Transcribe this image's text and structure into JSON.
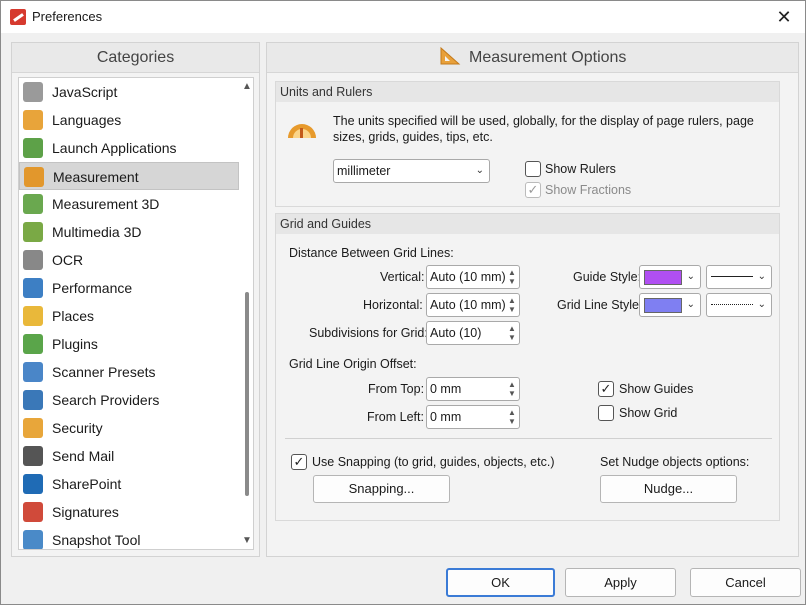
{
  "window": {
    "title": "Preferences"
  },
  "categories": {
    "heading": "Categories",
    "items": [
      {
        "label": "JavaScript",
        "icon": "javascript-icon",
        "color": "#9a9a9a"
      },
      {
        "label": "Languages",
        "icon": "languages-icon",
        "color": "#e8a43a"
      },
      {
        "label": "Launch Applications",
        "icon": "launch-applications-icon",
        "color": "#5da148"
      },
      {
        "label": "Measurement",
        "icon": "measurement-icon",
        "color": "#e2972c"
      },
      {
        "label": "Measurement 3D",
        "icon": "measurement-3d-icon",
        "color": "#6aa84f"
      },
      {
        "label": "Multimedia 3D",
        "icon": "multimedia-3d-icon",
        "color": "#7aa945"
      },
      {
        "label": "OCR",
        "icon": "ocr-icon",
        "color": "#888888"
      },
      {
        "label": "Performance",
        "icon": "performance-icon",
        "color": "#3d7fc4"
      },
      {
        "label": "Places",
        "icon": "places-icon",
        "color": "#e9b83a"
      },
      {
        "label": "Plugins",
        "icon": "plugins-icon",
        "color": "#5aa54a"
      },
      {
        "label": "Scanner Presets",
        "icon": "scanner-presets-icon",
        "color": "#4a86c8"
      },
      {
        "label": "Search Providers",
        "icon": "search-providers-icon",
        "color": "#3a78b8"
      },
      {
        "label": "Security",
        "icon": "security-icon",
        "color": "#e8a63a"
      },
      {
        "label": "Send Mail",
        "icon": "send-mail-icon",
        "color": "#555555"
      },
      {
        "label": "SharePoint",
        "icon": "sharepoint-icon",
        "color": "#1f6bb5"
      },
      {
        "label": "Signatures",
        "icon": "signatures-icon",
        "color": "#d04a3a"
      },
      {
        "label": "Snapshot Tool",
        "icon": "snapshot-tool-icon",
        "color": "#4a8ac8"
      }
    ],
    "selected_index": 3
  },
  "options": {
    "heading": "Measurement Options",
    "units": {
      "heading": "Units and Rulers",
      "description": "The units specified will be used, globally, for the display of page rulers, page sizes, grids, guides, tips, etc.",
      "unit_value": "millimeter",
      "show_rulers": {
        "label": "Show Rulers",
        "checked": false
      },
      "show_fractions": {
        "label": "Show Fractions",
        "checked": true,
        "disabled": true
      }
    },
    "grid": {
      "heading": "Grid and Guides",
      "distance_label": "Distance Between Grid Lines:",
      "vertical_label": "Vertical:",
      "vertical_value": "Auto (10 mm)",
      "horizontal_label": "Horizontal:",
      "horizontal_value": "Auto (10 mm)",
      "subdivisions_label": "Subdivisions for Grid:",
      "subdivisions_value": "Auto (10)",
      "guide_style_label": "Guide Style:",
      "guide_color": "#b04ff2",
      "grid_line_style_label": "Grid Line Style:",
      "grid_line_color": "#7f7ff2",
      "origin_label": "Grid Line Origin Offset:",
      "from_top_label": "From Top:",
      "from_top_value": "0 mm",
      "from_left_label": "From Left:",
      "from_left_value": "0 mm",
      "show_guides": {
        "label": "Show Guides",
        "checked": true
      },
      "show_grid": {
        "label": "Show Grid",
        "checked": false
      },
      "use_snapping": {
        "label": "Use Snapping (to grid, guides, objects, etc.)",
        "checked": true
      },
      "snapping_button": "Snapping...",
      "nudge_label": "Set Nudge objects options:",
      "nudge_button": "Nudge..."
    }
  },
  "footer": {
    "ok": "OK",
    "apply": "Apply",
    "cancel": "Cancel"
  }
}
